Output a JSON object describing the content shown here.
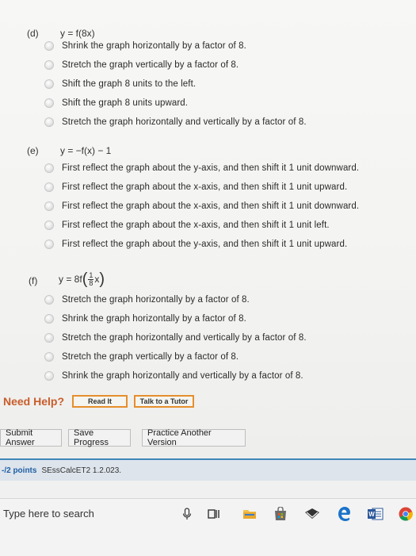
{
  "questions": [
    {
      "label": "(d)",
      "equation": "y = f(8x)",
      "options": [
        "Shrink the graph horizontally by a factor of 8.",
        "Stretch the graph vertically by a factor of 8.",
        "Shift the graph 8 units to the left.",
        "Shift the graph 8 units upward.",
        "Stretch the graph horizontally and vertically by a factor of 8."
      ]
    },
    {
      "label": "(e)",
      "equation": "y = −f(x) − 1",
      "options": [
        "First reflect the graph about the y-axis, and then shift it 1 unit downward.",
        "First reflect the graph about the x-axis, and then shift it 1 unit upward.",
        "First reflect the graph about the x-axis, and then shift it 1 unit downward.",
        "First reflect the graph about the x-axis, and then shift it 1 unit left.",
        "First reflect the graph about the y-axis, and then shift it 1 unit upward."
      ]
    },
    {
      "label": "(f)",
      "equation_prefix": "y = 8f",
      "frac_num": "1",
      "frac_den": "8",
      "equation_var": "x",
      "options": [
        "Stretch the graph horizontally by a factor of 8.",
        "Shrink the graph horizontally by a factor of 8.",
        "Stretch the graph horizontally and vertically by a factor of 8.",
        "Stretch the graph vertically by a factor of 8.",
        "Shrink the graph horizontally and vertically by a factor of 8."
      ]
    }
  ],
  "help": {
    "label": "Need Help?",
    "read_it": "Read It",
    "talk_to_tutor": "Talk to a Tutor"
  },
  "actions": {
    "submit": "Submit Answer",
    "save": "Save Progress",
    "practice": "Practice Another Version"
  },
  "points_bar": {
    "points": "-/2 points",
    "problem_id": "SEssCalcET2 1.2.023."
  },
  "taskbar": {
    "search_placeholder": "Type here to search",
    "icons": [
      "microphone-icon",
      "task-view-icon",
      "file-explorer-icon",
      "store-icon",
      "mail-icon",
      "edge-icon",
      "word-icon",
      "chrome-icon"
    ]
  },
  "colors": {
    "need_help": "#c85d2a",
    "button_border": "#e58f2c",
    "points": "#1f5fa3",
    "panel_line": "#3f86b8"
  }
}
